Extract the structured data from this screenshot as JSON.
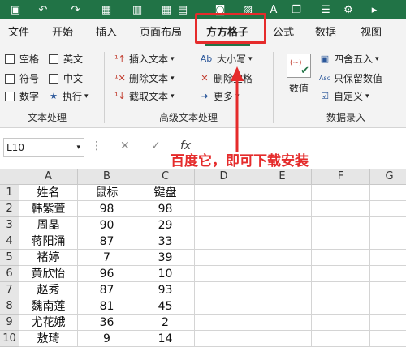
{
  "quick_access": {
    "icons": [
      "save-icon",
      "undo-icon",
      "redo-icon",
      "table-icon",
      "chart-icon",
      "grid-icon",
      "image-icon",
      "text-icon"
    ]
  },
  "tabs": [
    "文件",
    "开始",
    "插入",
    "页面布局",
    "方方格子",
    "公式",
    "数据",
    "视图"
  ],
  "active_tab": "方方格子",
  "ribbon": {
    "text_group": {
      "checks": [
        "空格",
        "英文",
        "符号",
        "中文",
        "数字"
      ],
      "execute": "执行",
      "label": "文本处理"
    },
    "advanced_group": {
      "items": [
        "插入文本",
        "删除文本",
        "截取文本",
        "大小写",
        "删除空格",
        "更多"
      ],
      "label": "高级文本处理"
    },
    "number_group": {
      "big_button": "数值",
      "items": [
        "四舍五入",
        "只保留数值",
        "自定义"
      ],
      "label": "数据录入"
    }
  },
  "formula_bar": {
    "name_box": "L10",
    "fx": "fx"
  },
  "annotation": "百度它，即可下载安装",
  "sheet": {
    "columns": [
      "A",
      "B",
      "C",
      "D",
      "E",
      "F",
      "G"
    ],
    "rows": [
      [
        "姓名",
        "鼠标",
        "键盘"
      ],
      [
        "韩紫萱",
        "98",
        "98"
      ],
      [
        "周晶",
        "90",
        "29"
      ],
      [
        "蒋阳涌",
        "87",
        "33"
      ],
      [
        "褚婷",
        "7",
        "39"
      ],
      [
        "黄欣怡",
        "96",
        "10"
      ],
      [
        "赵秀",
        "87",
        "93"
      ],
      [
        "魏南莲",
        "81",
        "45"
      ],
      [
        "尤花娥",
        "36",
        "2"
      ],
      [
        "敖琦",
        "9",
        "14"
      ]
    ]
  }
}
